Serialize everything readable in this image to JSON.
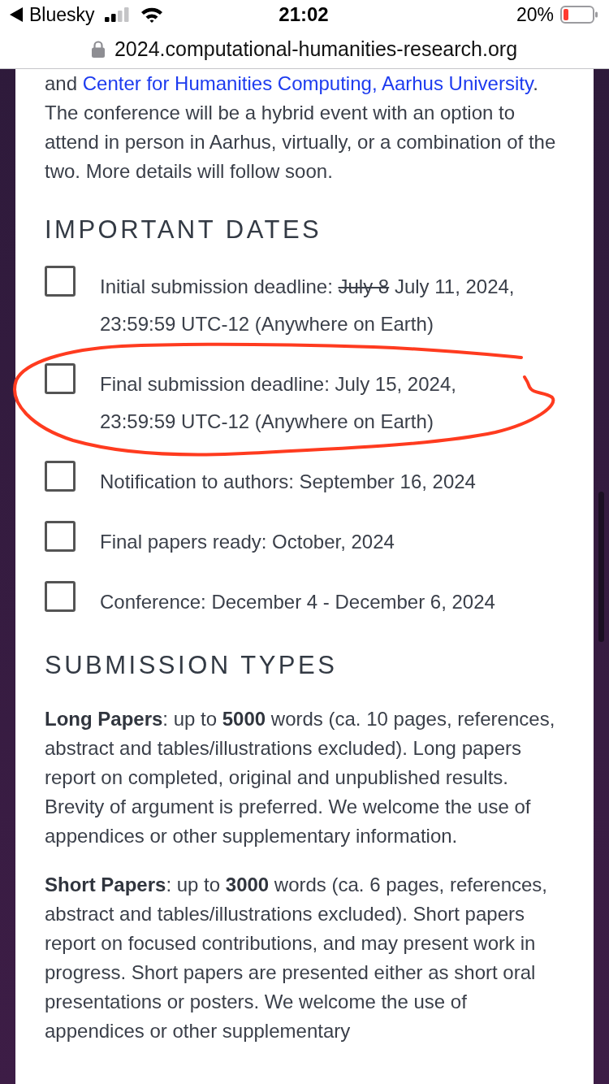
{
  "status_bar": {
    "back_label": "Bluesky",
    "time": "21:02",
    "battery": "20%"
  },
  "address_bar": {
    "url": "2024.computational-humanities-research.org",
    "secure": true
  },
  "intro": {
    "before": "and",
    "link": "Center for Humanities Computing, Aarhus University",
    "after": ". The conference will be a hybrid event with an option to attend in person in Aarhus, virtually, or a combination of the two. More details will follow soon."
  },
  "sections": [
    {
      "kind": "checklist",
      "heading": "IMPORTANT DATES",
      "items": [
        {
          "checked": false,
          "circled": false,
          "parts": [
            {
              "text": "Initial submission deadline:",
              "struck": false
            },
            {
              "text": "July 8",
              "struck": true
            },
            {
              "text": "July 11, 2024, 23:59:59 UTC-12 (Anywhere on Earth)",
              "struck": false
            }
          ]
        },
        {
          "checked": false,
          "circled": true,
          "parts": [
            {
              "text": "Final submission deadline: July 15, 2024, 23:59:59 UTC-12 (Anywhere on Earth)",
              "struck": false
            }
          ]
        },
        {
          "checked": false,
          "circled": false,
          "parts": [
            {
              "text": "Notification to authors: September 16, 2024",
              "struck": false
            }
          ]
        },
        {
          "checked": false,
          "circled": false,
          "parts": [
            {
              "text": "Final papers ready: October, 2024",
              "struck": false
            }
          ]
        },
        {
          "checked": false,
          "circled": false,
          "parts": [
            {
              "text": "Conference: December 4 - December 6, 2024",
              "struck": false
            }
          ]
        }
      ]
    },
    {
      "kind": "paragraphs",
      "heading": "SUBMISSION TYPES",
      "paragraphs": [
        "**Long Papers**: up to **5000** words (ca. 10 pages, references, abstract and tables/illustrations excluded). Long papers report on completed, original and unpublished results. Brevity of argument is preferred. We welcome the use of appendices or other supplementary information.",
        "**Short Papers**: up to **3000** words (ca. 6 pages, references, abstract and tables/illustrations excluded). Short papers report on focused contributions, and may present work in progress. Short papers are presented either as short oral presentations or posters. We welcome the use of appendices or other supplementary"
      ]
    }
  ]
}
